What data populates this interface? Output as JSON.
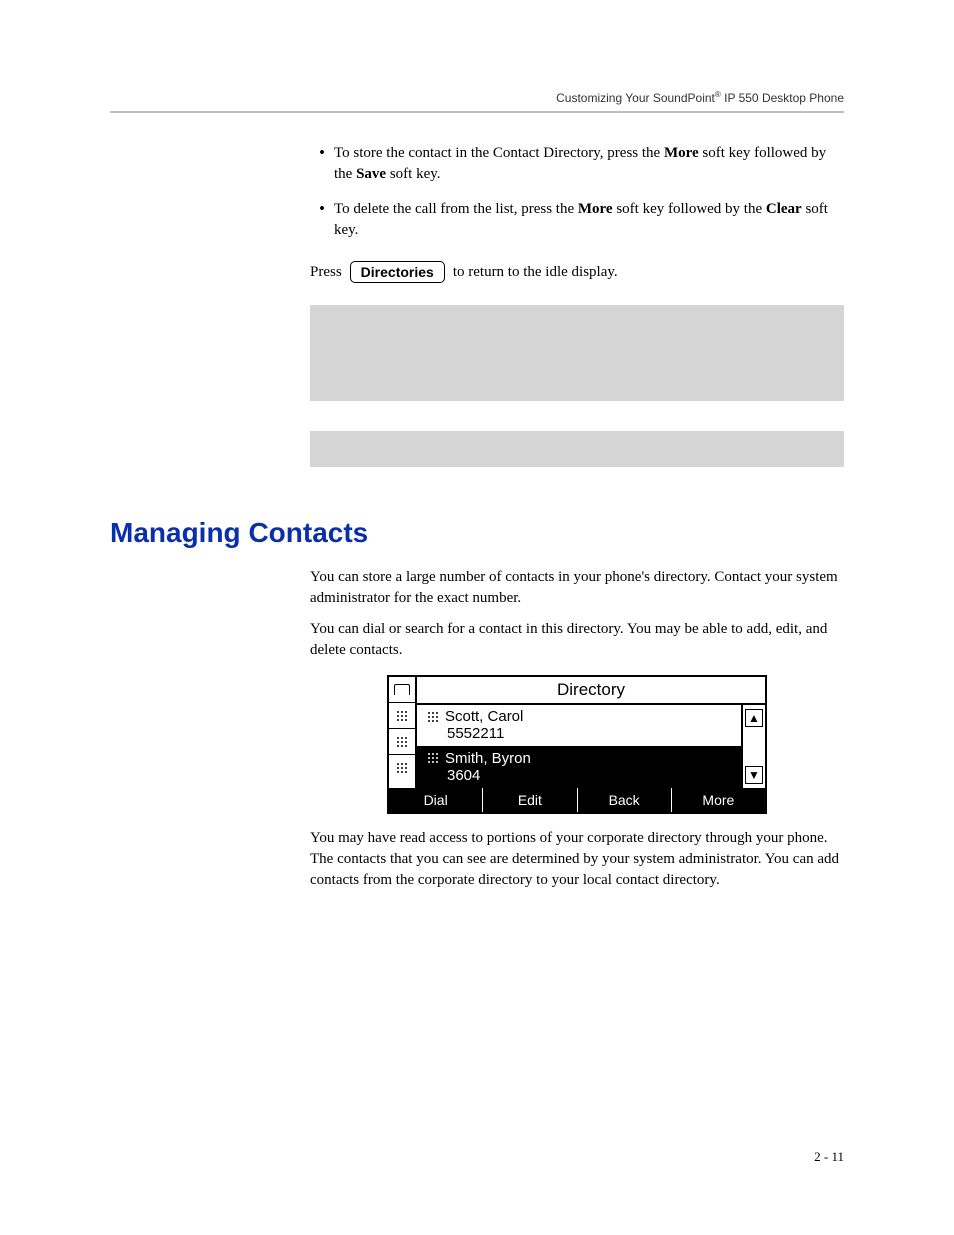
{
  "header": {
    "prefix": "Customizing Your SoundPoint",
    "reg": "®",
    "suffix": " IP 550 Desktop Phone"
  },
  "bullets": [
    {
      "t1": "To store the contact in the Contact Directory, press the ",
      "b1": "More",
      "t2": " soft key followed by the ",
      "b2": "Save",
      "t3": " soft key."
    },
    {
      "t1": "To delete the call from the list, press the ",
      "b1": "More",
      "t2": " soft key followed by the ",
      "b2": "Clear",
      "t3": " soft key."
    }
  ],
  "press": {
    "before": "Press",
    "button": "Directories",
    "after": " to return to the idle display."
  },
  "heading": "Managing Contacts",
  "para1": "You can store a large number of contacts in your phone's directory. Contact your system administrator for the exact number.",
  "para2": "You can dial or search for a contact in this directory. You may be able to add, edit, and delete contacts.",
  "phone": {
    "title": "Directory",
    "entries": [
      {
        "name": "Scott, Carol",
        "number": "5552211",
        "selected": false
      },
      {
        "name": "Smith, Byron",
        "number": "3604",
        "selected": true
      }
    ],
    "softkeys": [
      "Dial",
      "Edit",
      "Back",
      "More"
    ]
  },
  "para3": "You may have read access to portions of your corporate directory through your phone. The contacts that you can see are determined by your system administrator. You can add contacts from the corporate directory to your local contact directory.",
  "pagenum": "2 - 11"
}
